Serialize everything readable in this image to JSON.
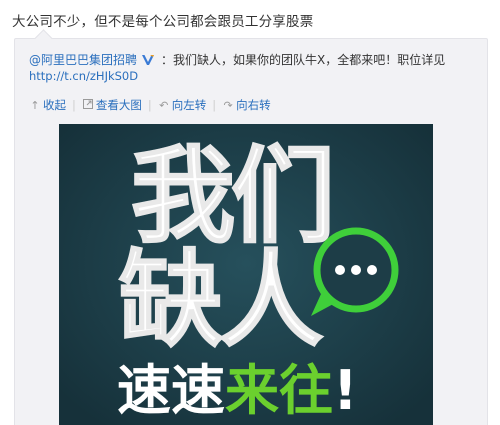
{
  "post": {
    "text": "大公司不少，但不是每个公司都会跟员工分享股票"
  },
  "original": {
    "author": "@阿里巴巴集团招聘",
    "text": "：我们缺人，如果你的团队牛X，全都来吧！职位详见",
    "link": "http://t.cn/zHJkS0D"
  },
  "actions": {
    "collapse": "收起",
    "view_large": "查看大图",
    "rotate_left": "向左转",
    "rotate_right": "向右转"
  },
  "icons": {
    "collapse": "collapse-up-icon",
    "view_large": "view-large-icon",
    "rotate_left": "rotate-left-icon",
    "rotate_right": "rotate-right-icon",
    "verified": "verified-v-icon",
    "chat": "chat-bubble-icon"
  },
  "poster": {
    "line1": "我们",
    "line2": "缺人",
    "line3_white": "速速",
    "line3_green": "来往",
    "line3_end": "!"
  },
  "colors": {
    "link": "#2a6fbd",
    "poster_bg": "#1d3d47",
    "poster_green": "#6bd02e",
    "chat_green": "#3fcf3a"
  }
}
